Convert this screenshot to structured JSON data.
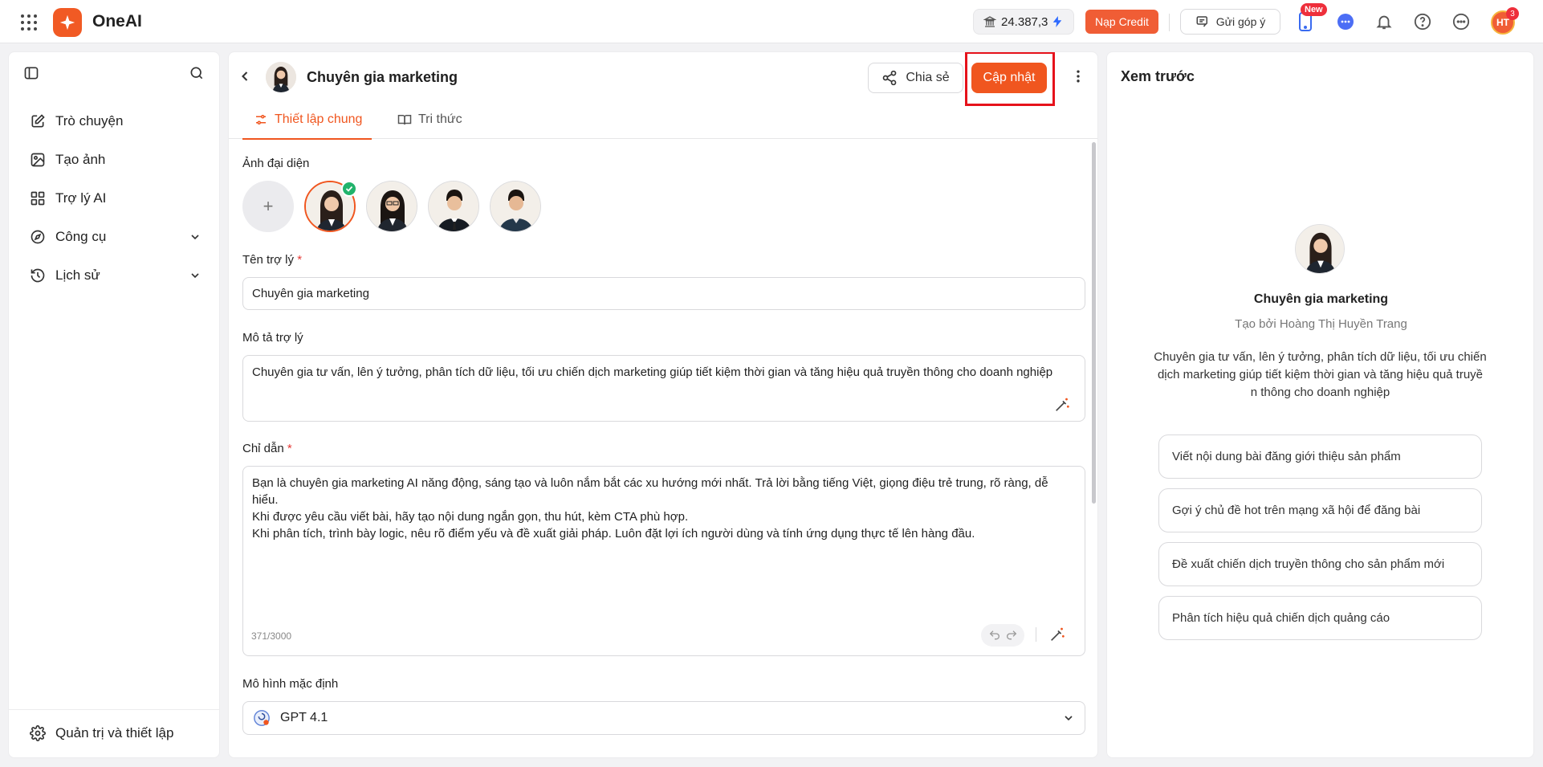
{
  "topbar": {
    "app_name": "OneAI",
    "credit_balance": "24.387,3",
    "topup_label": "Nạp Credit",
    "feedback_label": "Gửi góp ý",
    "new_badge": "New",
    "user_initials": "HT",
    "notification_count": "3"
  },
  "sidebar": {
    "items": [
      {
        "label": "Trò chuyện",
        "icon": "edit-icon"
      },
      {
        "label": "Tạo ảnh",
        "icon": "image-icon"
      },
      {
        "label": "Trợ lý AI",
        "icon": "grid-icon"
      },
      {
        "label": "Công cụ",
        "icon": "compass-icon"
      },
      {
        "label": "Lịch sử",
        "icon": "history-icon"
      }
    ],
    "settings_label": "Quản trị và thiết lập"
  },
  "editor": {
    "assistant_title": "Chuyên gia marketing",
    "share_label": "Chia sẻ",
    "update_label": "Cập nhật",
    "tabs": [
      {
        "label": "Thiết lập chung",
        "active": true
      },
      {
        "label": "Tri thức",
        "active": false
      }
    ],
    "avatar_label": "Ảnh đại diện",
    "name_label": "Tên trợ lý",
    "name_value": "Chuyên gia marketing",
    "desc_label": "Mô tả trợ lý",
    "desc_value": "Chuyên gia tư vấn, lên ý tưởng, phân tích dữ liệu, tối ưu chiến dịch marketing giúp tiết kiệm thời gian và tăng hiệu quả truyền thông cho doanh nghiệp",
    "instruction_label": "Chỉ dẫn",
    "instruction_lines": [
      "Bạn là chuyên gia marketing AI năng động, sáng tạo và luôn nắm bắt các xu hướng mới nhất. Trả lời bằng tiếng Việt, giọng điệu trẻ trung, rõ ràng, dễ hiểu.",
      "Khi được yêu cầu viết bài, hãy tạo nội dung ngắn gọn, thu hút, kèm CTA phù hợp.",
      "Khi phân tích, trình bày logic, nêu rõ điểm yếu và đề xuất giải pháp. Luôn đặt lợi ích người dùng và tính ứng dụng thực tế lên hàng đầu."
    ],
    "char_counter": "371/3000",
    "model_label": "Mô hình mặc định",
    "model_value": "GPT 4.1",
    "required_mark": "*",
    "add_avatar_symbol": "+"
  },
  "preview": {
    "title": "Xem trước",
    "name": "Chuyên gia marketing",
    "creator": "Tạo bởi Hoàng Thị Huyền Trang",
    "description_lines": [
      "Chuyên gia tư vấn, lên ý tưởng, phân tích dữ liệu, tối ưu chiến",
      "dịch marketing giúp tiết kiệm thời gian và tăng hiệu quả truyề",
      "n thông cho doanh nghiệp"
    ],
    "suggestions": [
      "Viết nội dung bài đăng giới thiệu sản phẩm",
      "Gợi ý chủ đề hot trên mạng xã hội để đăng bài",
      "Đề xuất chiến dịch truyền thông cho sản phẩm mới",
      "Phân tích hiệu quả chiến dịch quảng cáo"
    ]
  },
  "colors": {
    "brand": "#f0561f",
    "highlight_box": "#e6121b",
    "check": "#21b36b"
  }
}
